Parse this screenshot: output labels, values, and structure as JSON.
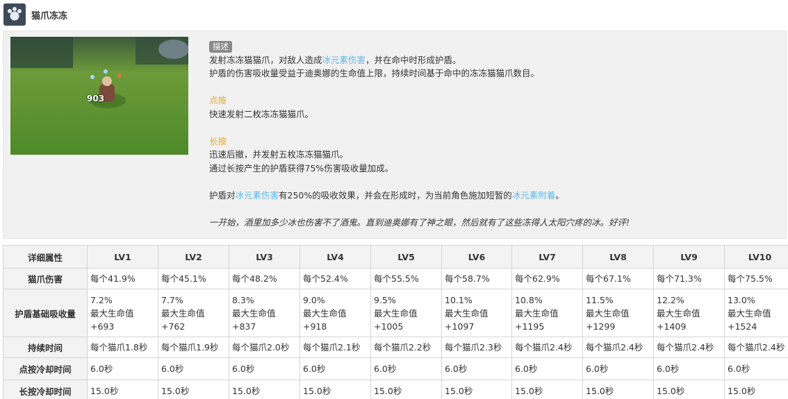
{
  "skill": {
    "title": "猫爪冻冻",
    "icon": "cat-paw-icon",
    "preview_damage": "903"
  },
  "description": {
    "tag": "描述",
    "line1": {
      "a": "发射冻冻猫猫爪，对敌人造成",
      "hl": "冰元素伤害",
      "b": "，并在命中时形成护盾。"
    },
    "line2": "护盾的伤害吸收量受益于迪奥娜的生命值上限，持续时间基于命中的冻冻猫猫爪数目。",
    "tap_title": "点按",
    "tap_text": "快速发射二枚冻冻猫猫爪。",
    "hold_title": "长按",
    "hold_line1": "迅速后撤，并发射五枚冻冻猫猫爪。",
    "hold_line2": "通过长按产生的护盾获得75%伤害吸收量加成。",
    "shield": {
      "a": "护盾对",
      "hl1": "冰元素伤害",
      "b": "有250%的吸收效果，并会在形成时，为当前角色施加短暂的",
      "hl2": "冰元素附着",
      "c": "。"
    },
    "quote": "一开始，酒里加多少冰也伤害不了酒鬼。直到迪奥娜有了神之眼，然后就有了这些冻得人太阳穴疼的冰。好评!"
  },
  "colors": {
    "highlight": "#5cb8e6",
    "subtitle": "#e0a830"
  },
  "table": {
    "header": [
      "详细属性",
      "LV1",
      "LV2",
      "LV3",
      "LV4",
      "LV5",
      "LV6",
      "LV7",
      "LV8",
      "LV9",
      "LV10"
    ],
    "rows": [
      {
        "label": "猫爪伤害",
        "cells": [
          [
            "每个41.9%"
          ],
          [
            "每个45.1%"
          ],
          [
            "每个48.2%"
          ],
          [
            "每个52.4%"
          ],
          [
            "每个55.5%"
          ],
          [
            "每个58.7%"
          ],
          [
            "每个62.9%"
          ],
          [
            "每个67.1%"
          ],
          [
            "每个71.3%"
          ],
          [
            "每个75.5%"
          ]
        ]
      },
      {
        "label": "护盾基础吸收量",
        "cells": [
          [
            "7.2%",
            "最大生命值",
            "+693"
          ],
          [
            "7.7%",
            "最大生命值",
            "+762"
          ],
          [
            "8.3%",
            "最大生命值",
            "+837"
          ],
          [
            "9.0%",
            "最大生命值",
            "+918"
          ],
          [
            "9.5%",
            "最大生命值",
            "+1005"
          ],
          [
            "10.1%",
            "最大生命值",
            "+1097"
          ],
          [
            "10.8%",
            "最大生命值",
            "+1195"
          ],
          [
            "11.5%",
            "最大生命值",
            "+1299"
          ],
          [
            "12.2%",
            "最大生命值",
            "+1409"
          ],
          [
            "13.0%",
            "最大生命值",
            "+1524"
          ]
        ]
      },
      {
        "label": "持续时间",
        "cells": [
          [
            "每个猫爪1.8秒"
          ],
          [
            "每个猫爪1.9秒"
          ],
          [
            "每个猫爪2.0秒"
          ],
          [
            "每个猫爪2.1秒"
          ],
          [
            "每个猫爪2.2秒"
          ],
          [
            "每个猫爪2.3秒"
          ],
          [
            "每个猫爪2.4秒"
          ],
          [
            "每个猫爪2.4秒"
          ],
          [
            "每个猫爪2.4秒"
          ],
          [
            "每个猫爪2.4秒"
          ]
        ]
      },
      {
        "label": "点按冷却时间",
        "cells": [
          [
            "6.0秒"
          ],
          [
            "6.0秒"
          ],
          [
            "6.0秒"
          ],
          [
            "6.0秒"
          ],
          [
            "6.0秒"
          ],
          [
            "6.0秒"
          ],
          [
            "6.0秒"
          ],
          [
            "6.0秒"
          ],
          [
            "6.0秒"
          ],
          [
            "6.0秒"
          ]
        ]
      },
      {
        "label": "长按冷却时间",
        "cells": [
          [
            "15.0秒"
          ],
          [
            "15.0秒"
          ],
          [
            "15.0秒"
          ],
          [
            "15.0秒"
          ],
          [
            "15.0秒"
          ],
          [
            "15.0秒"
          ],
          [
            "15.0秒"
          ],
          [
            "15.0秒"
          ],
          [
            "15.0秒"
          ],
          [
            "15.0秒"
          ]
        ]
      }
    ]
  }
}
